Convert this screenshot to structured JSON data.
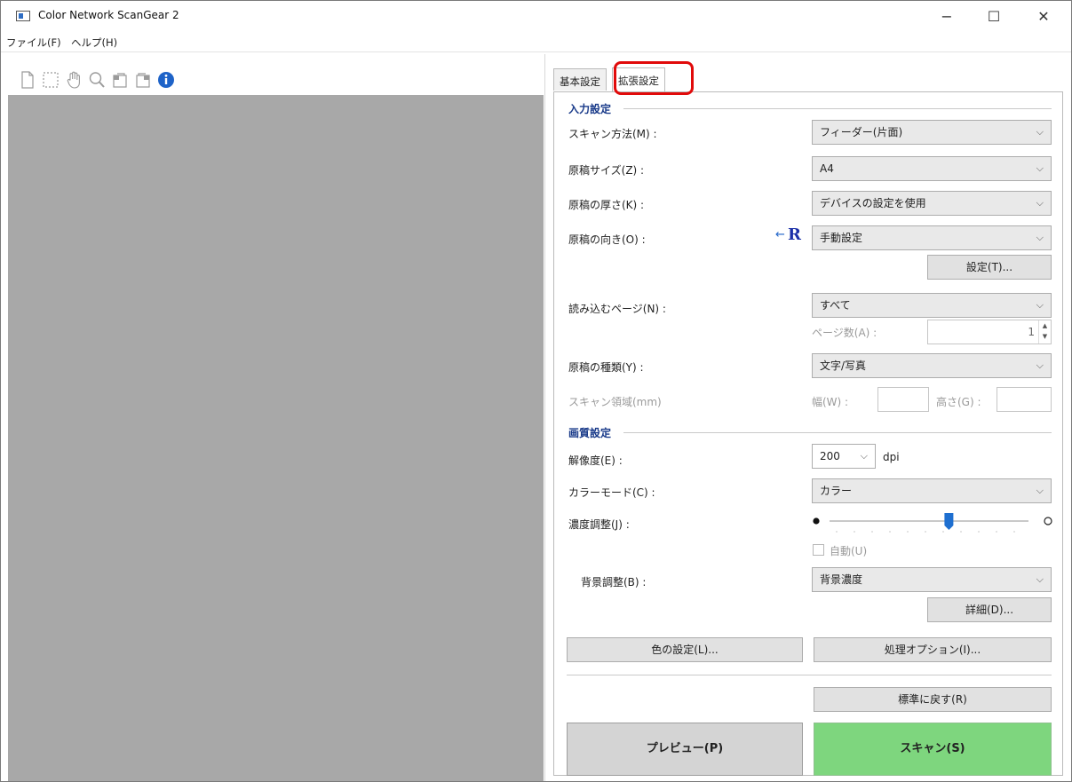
{
  "window": {
    "title": "Color Network ScanGear 2",
    "minimize": "−",
    "maximize": "☐",
    "close": "✕"
  },
  "menu": [
    "ファイル(F)",
    "ヘルプ(H)"
  ],
  "toolbar": {
    "icons": [
      "new-page-icon",
      "selection-icon",
      "hand-icon",
      "zoom-icon",
      "rotate-left-icon",
      "rotate-right-icon",
      "info-icon"
    ]
  },
  "tabs": [
    {
      "label": "基本設定"
    },
    {
      "label": "拡張設定"
    }
  ],
  "input_section": {
    "title": "入力設定",
    "scan_method_label": "スキャン方法(M) :",
    "scan_method_value": "フィーダー(片面)",
    "size_label": "原稿サイズ(Z) :",
    "size_value": "A4",
    "thickness_label": "原稿の厚さ(K) :",
    "thickness_value": "デバイスの設定を使用",
    "orientation_label": "原稿の向き(O) :",
    "orientation_value": "手動設定",
    "orientation_glyph": "R",
    "settings_button": "設定(T)...",
    "pages_label": "読み込むページ(N) :",
    "pages_value": "すべて",
    "page_count_label": "ページ数(A) :",
    "page_count_value": "1",
    "doc_type_label": "原稿の種類(Y) :",
    "doc_type_value": "文字/写真",
    "scan_area_label": "スキャン領域(mm)",
    "width_label": "幅(W) :",
    "height_label": "高さ(G) :"
  },
  "quality_section": {
    "title": "画質設定",
    "resolution_label": "解像度(E) :",
    "resolution_value": "200",
    "resolution_unit": "dpi",
    "color_mode_label": "カラーモード(C) :",
    "color_mode_value": "カラー",
    "density_label": "濃度調整(J) :",
    "density_level": 0.6,
    "auto_label": "自動(U)",
    "bg_label": "背景調整(B) :",
    "bg_value": "背景濃度",
    "detail_button": "詳細(D)..."
  },
  "buttons": {
    "color_settings": "色の設定(L)...",
    "processing_options": "処理オプション(I)...",
    "restore_default": "標準に戻す(R)",
    "preview": "プレビュー(P)",
    "scan": "スキャン(S)"
  },
  "colors": {
    "section_title": "#1a3b8a",
    "scan_button": "#7ed67e",
    "highlight": "#e10a0a",
    "slider_thumb": "#1e6fd0"
  }
}
